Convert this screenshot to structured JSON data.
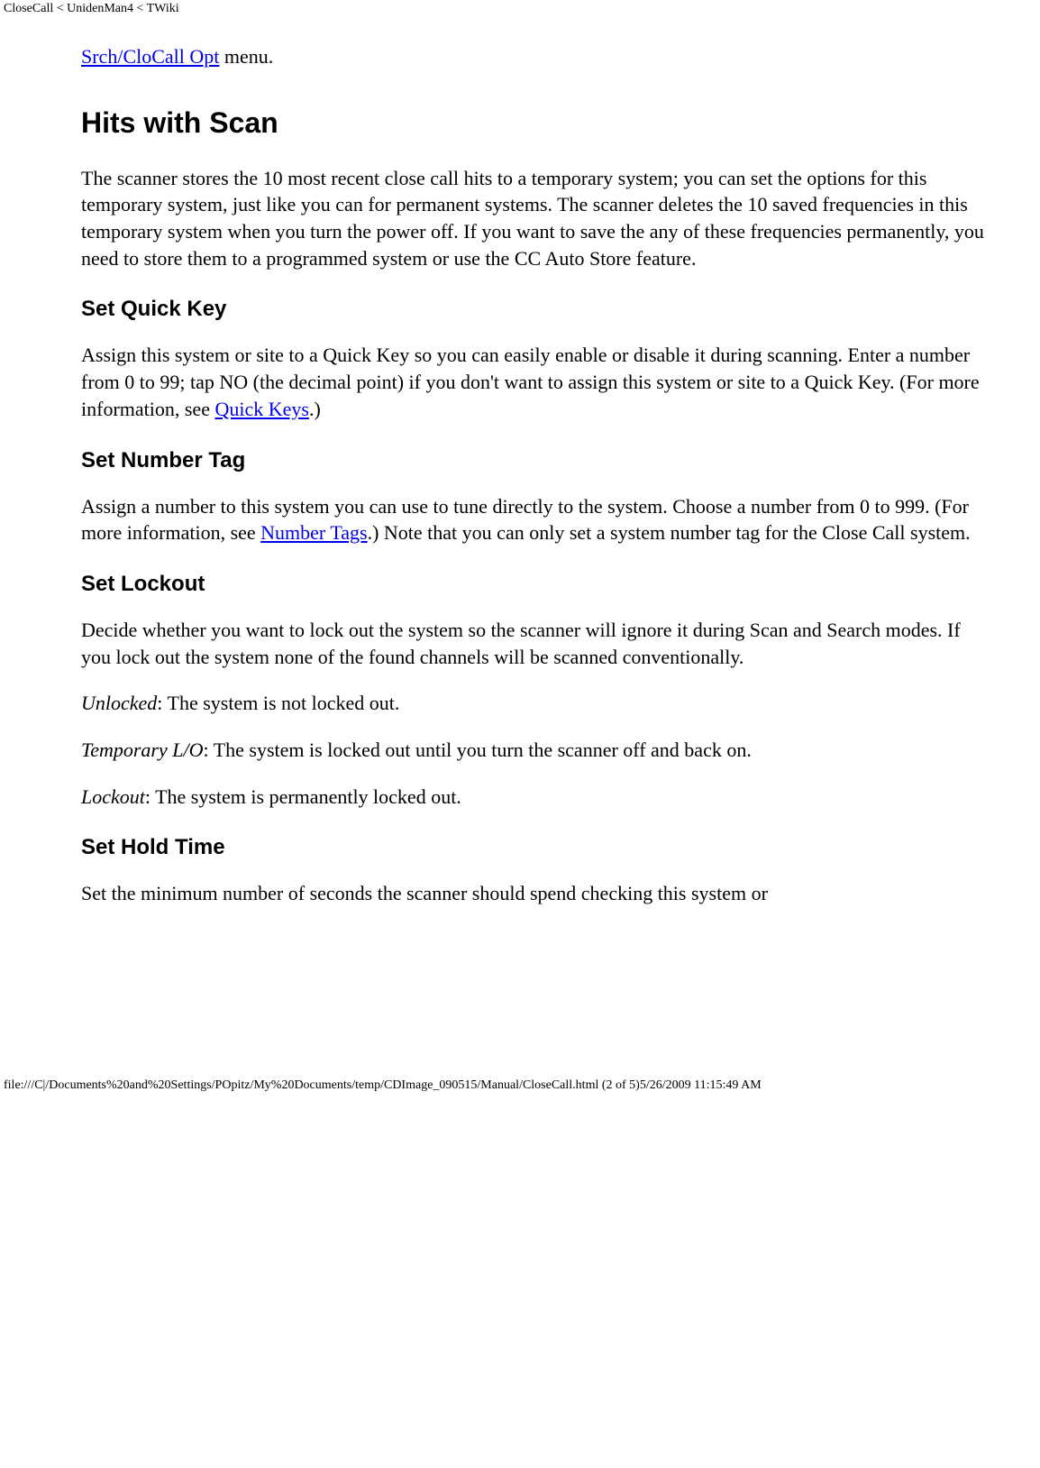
{
  "header": {
    "breadcrumb": "CloseCall < UnidenMan4 < TWiki"
  },
  "top_line": {
    "link_text": "Srch/CloCall Opt",
    "after_link": " menu."
  },
  "section_hits": {
    "heading": "Hits with Scan",
    "para": "The scanner stores the 10 most recent close call hits to a temporary system; you can set the options for this temporary system, just like you can for permanent systems. The scanner deletes the 10 saved frequencies in this temporary system when you turn the power off. If you want to save the any of these frequencies permanently, you need to store them to a programmed system or use the CC Auto Store feature."
  },
  "section_quickkey": {
    "heading": "Set Quick Key",
    "para_before": "Assign this system or site to a Quick Key so you can easily enable or disable it during scanning. Enter a number from 0 to 99; tap NO (the decimal point) if you don't want to assign this system or site to a Quick Key. (For more information, see ",
    "link_text": "Quick Keys",
    "para_after": ".)"
  },
  "section_numbertag": {
    "heading": "Set Number Tag",
    "para_before": "Assign a number to this system you can use to tune directly to the system. Choose a number from 0 to 999. (For more information, see ",
    "link_text": "Number Tags",
    "para_after": ".) Note that you can only set a system number tag for the Close Call system."
  },
  "section_lockout": {
    "heading": "Set Lockout",
    "para": "Decide whether you want to lock out the system so the scanner will ignore it during Scan and Search modes. If you lock out the system none of the found channels will be scanned conventionally.",
    "unlocked_label": "Unlocked",
    "unlocked_text": ": The system is not locked out.",
    "temp_label": "Temporary L/O",
    "temp_text": ": The system is locked out until you turn the scanner off and back on.",
    "lockout_label": "Lockout",
    "lockout_text": ": The system is permanently locked out."
  },
  "section_holdtime": {
    "heading": "Set Hold Time",
    "para": "Set the minimum number of seconds the scanner should spend checking this system or"
  },
  "footer": {
    "text": "file:///C|/Documents%20and%20Settings/POpitz/My%20Documents/temp/CDImage_090515/Manual/CloseCall.html (2 of 5)5/26/2009 11:15:49 AM"
  }
}
